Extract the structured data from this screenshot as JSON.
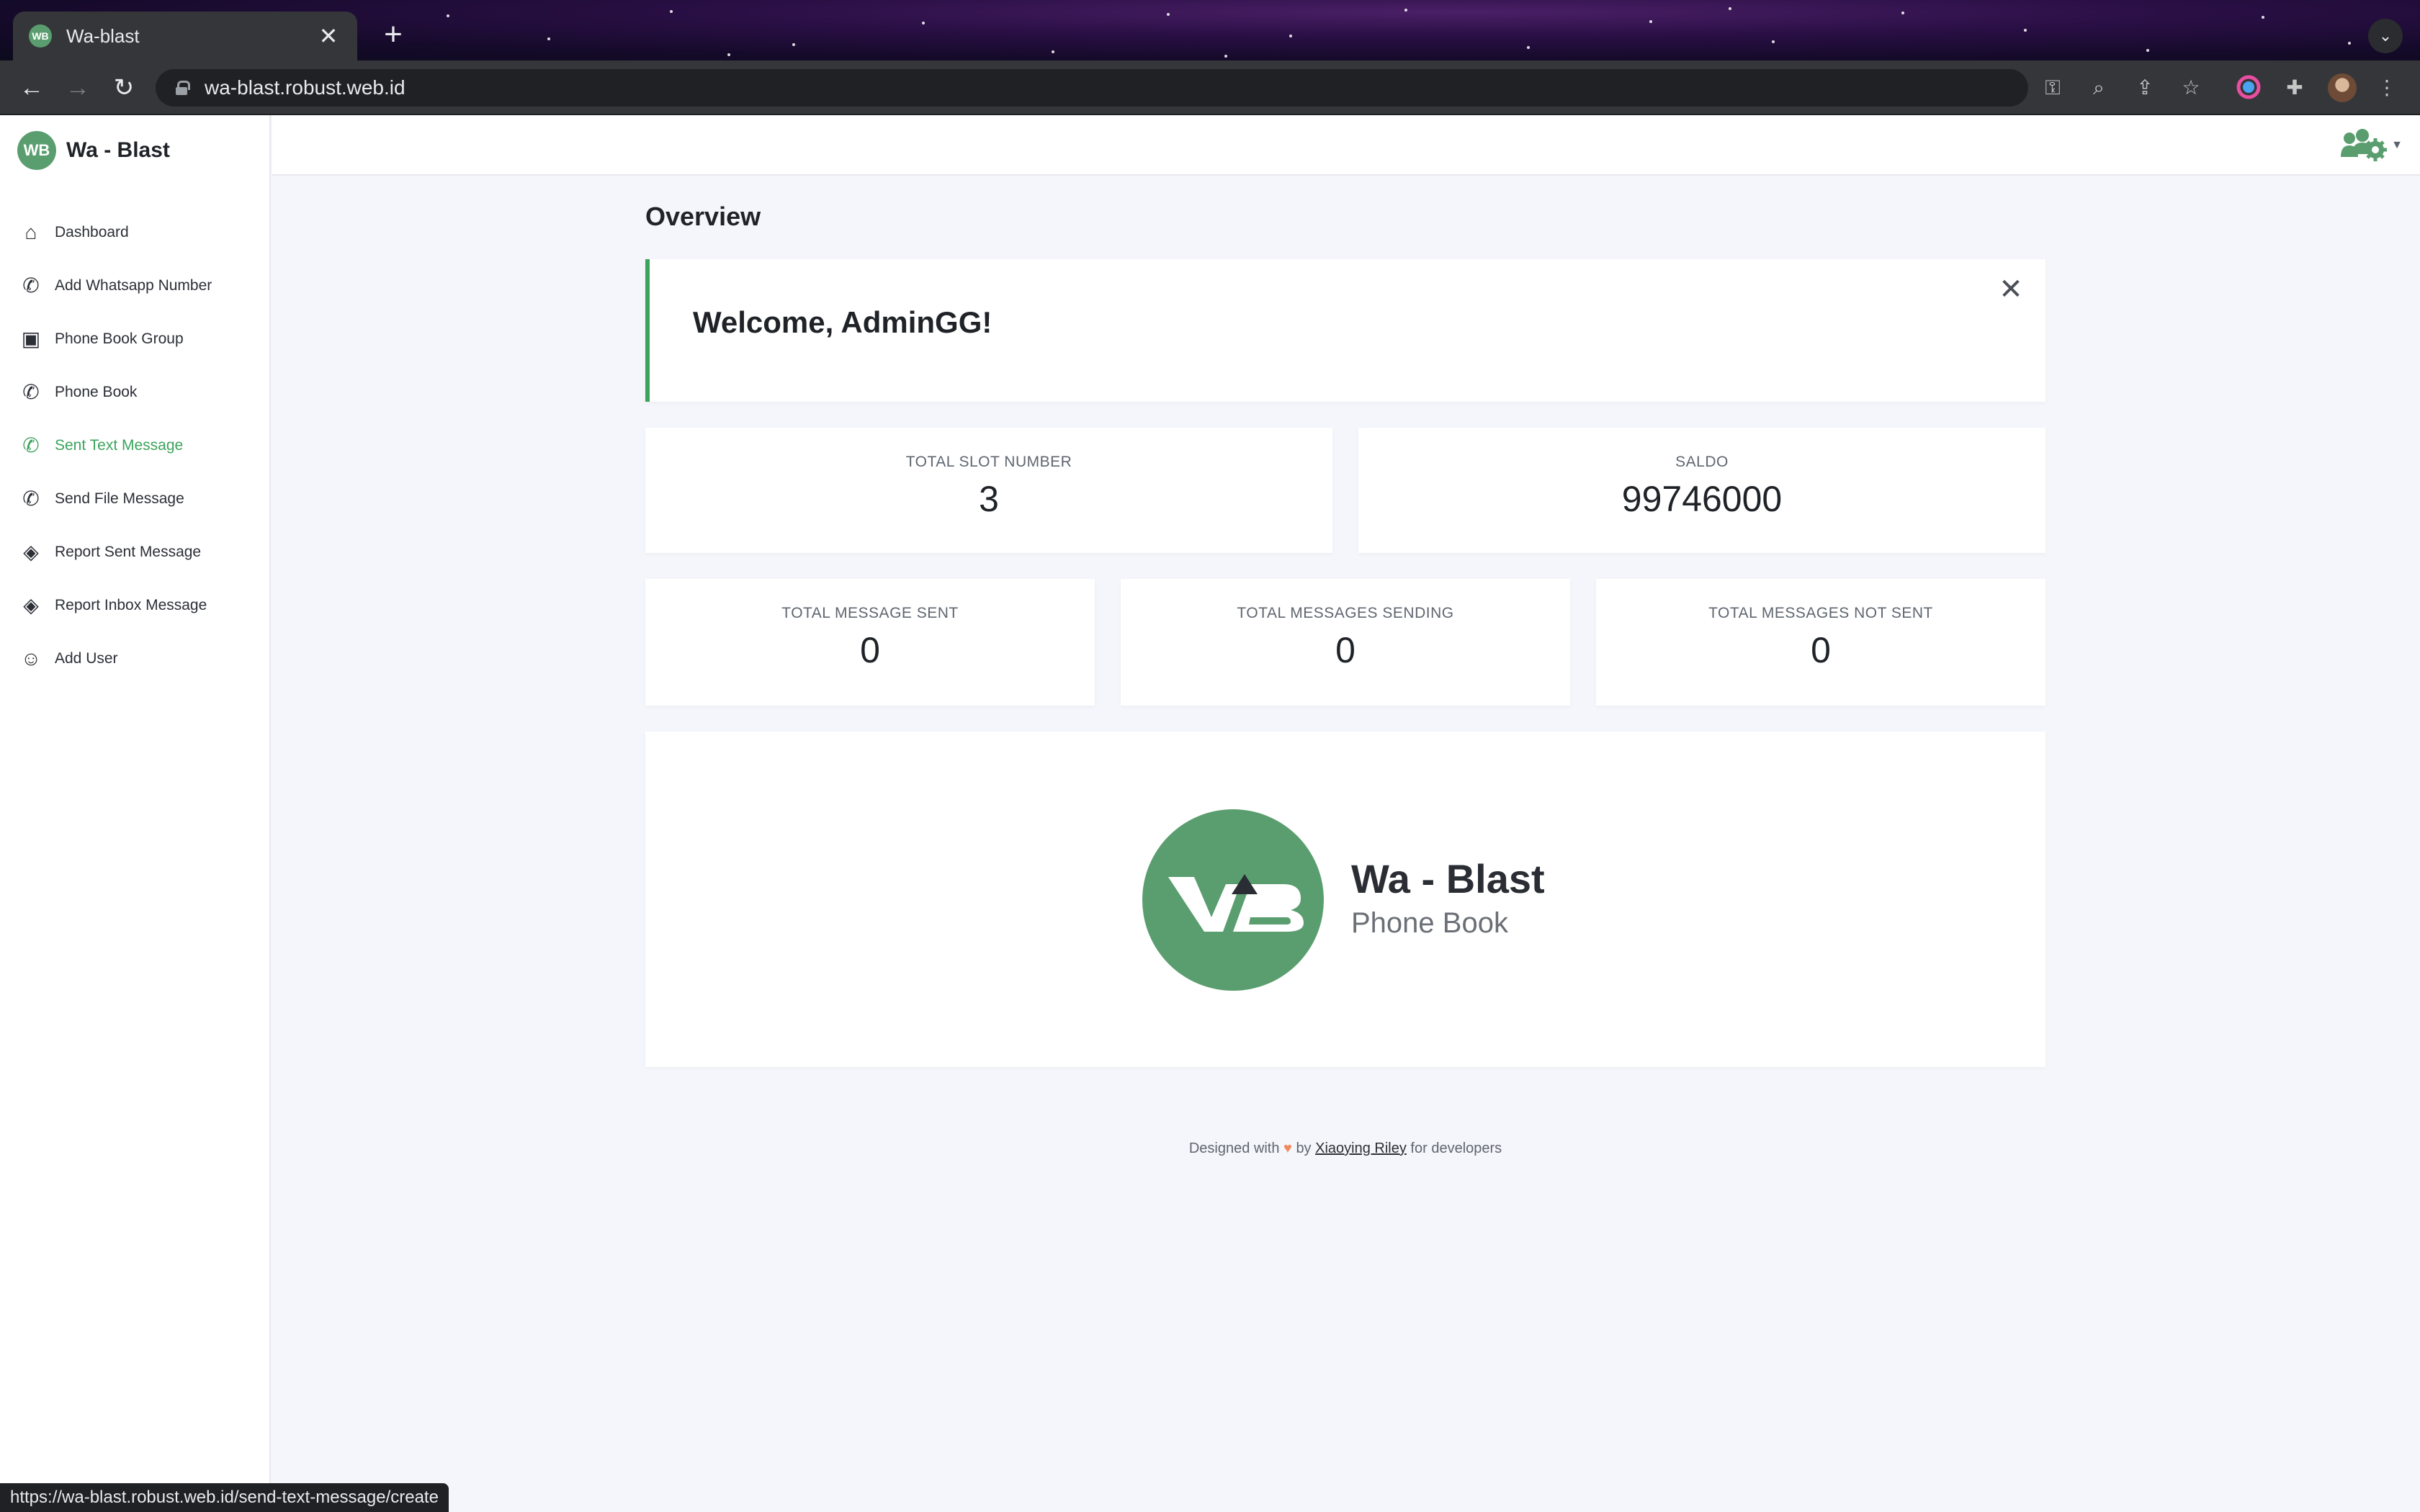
{
  "browser": {
    "tab_title": "Wa-blast",
    "new_tab_symbol": "+",
    "close_symbol": "✕",
    "url": "wa-blast.robust.web.id",
    "status_url": "https://wa-blast.robust.web.id/send-text-message/create"
  },
  "brand": {
    "name": "Wa - Blast",
    "logo_text": "WB",
    "color": "#5a9e6f"
  },
  "sidebar": {
    "items": [
      {
        "label": "Dashboard",
        "icon": "home-icon"
      },
      {
        "label": "Add Whatsapp Number",
        "icon": "whatsapp-icon"
      },
      {
        "label": "Phone Book Group",
        "icon": "contact-book-icon"
      },
      {
        "label": "Phone Book",
        "icon": "phone-icon"
      },
      {
        "label": "Sent Text Message",
        "icon": "whatsapp-icon",
        "active": true
      },
      {
        "label": "Send File Message",
        "icon": "whatsapp-icon"
      },
      {
        "label": "Report Sent Message",
        "icon": "layers-icon"
      },
      {
        "label": "Report Inbox Message",
        "icon": "layers-icon"
      },
      {
        "label": "Add User",
        "icon": "user-icon"
      }
    ],
    "active_color": "#3ca35c"
  },
  "main": {
    "title": "Overview",
    "welcome": "Welcome, AdminGG!",
    "stats_top": [
      {
        "label": "TOTAL SLOT NUMBER",
        "value": "3"
      },
      {
        "label": "SALDO",
        "value": "99746000"
      }
    ],
    "stats_bottom": [
      {
        "label": "TOTAL MESSAGE SENT",
        "value": "0"
      },
      {
        "label": "TOTAL MESSAGES SENDING",
        "value": "0"
      },
      {
        "label": "TOTAL MESSAGES NOT SENT",
        "value": "0"
      }
    ],
    "banner": {
      "title": "Wa - Blast",
      "subtitle": "Phone Book"
    }
  },
  "footer": {
    "prefix": "Designed with",
    "heart": "♥",
    "by": "by",
    "author": "Xiaoying Riley",
    "suffix": "for developers"
  }
}
